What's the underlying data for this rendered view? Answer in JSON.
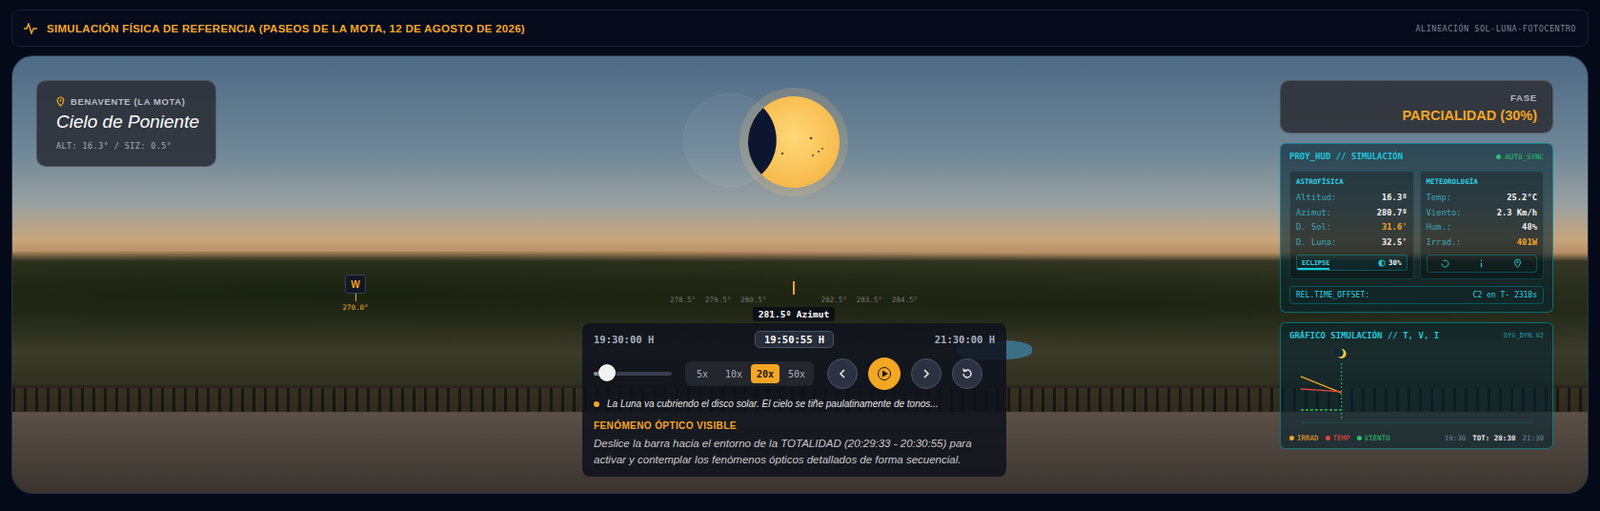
{
  "header": {
    "title": "SIMULACIÓN FÍSICA DE REFERENCIA (PASEOS DE LA MOTA, 12 DE AGOSTO DE 2026)",
    "subtitle": "ALINEACIÓN SOL-LUNA-FOTOCENTRO"
  },
  "location": {
    "place": "BENAVENTE (LA MOTA)",
    "title": "Cielo de Poniente",
    "meta": "ALT: 16.3° / SIZ: 0.5°"
  },
  "sky": {
    "eclipse_coverage": 0.3,
    "compass": {
      "label": "W",
      "degrees": "270.0°"
    },
    "azimuth_ticks": [
      "278.5°",
      "279.5°",
      "280.5°",
      "282.5°",
      "283.5°",
      "284.5°"
    ],
    "azimuth_label": "281.5º Azimut"
  },
  "phase": {
    "label": "FASE",
    "value": "PARCIALIDAD (30%)"
  },
  "timeline": {
    "start": "19:30:00 H",
    "current": "19:50:55 H",
    "end": "21:30:00 H",
    "level": 0.17,
    "speeds": [
      {
        "label": "5x",
        "selected": false
      },
      {
        "label": "10x",
        "selected": false
      },
      {
        "label": "20x",
        "selected": true
      },
      {
        "label": "50x",
        "selected": false
      }
    ],
    "message": "La Luna va cubriendo el disco solar. El cielo se tiñe paulatinamente de tonos...",
    "notice_title": "FENÓMENO ÓPTICO VISIBLE",
    "notice_text": "Deslice la barra hacia el entorno de la TOTALIDAD (20:29:33 - 20:30:55) para activar y contemplar los fenómenos ópticos detallados de forma secuencial."
  },
  "hud": {
    "title": "PROY_HUD // SIMULACIÓN",
    "sync": "AUTO_SYNC",
    "astro": {
      "title": "ASTROFÍSICA",
      "rows": [
        {
          "label": "Altitud:",
          "value": "16.3º",
          "highlight": false
        },
        {
          "label": "Azimut:",
          "value": "280.7º",
          "highlight": false
        },
        {
          "label": "D. Sol:",
          "value": "31.6'",
          "highlight": true
        },
        {
          "label": "D. Luna:",
          "value": "32.5'",
          "highlight": false
        }
      ]
    },
    "eclipse": {
      "label": "ECLIPSE",
      "value": "30%",
      "level": 0.3
    },
    "meteo": {
      "title": "METEOROLOGÍA",
      "rows": [
        {
          "label": "Temp:",
          "value": "25.2°C",
          "highlight": false
        },
        {
          "label": "Viento:",
          "value": "2.3 Km/h",
          "highlight": false
        },
        {
          "label": "Hum.:",
          "value": "48%",
          "highlight": false
        },
        {
          "label": "Irrad.:",
          "value": "401W",
          "highlight": true
        }
      ]
    },
    "offset": {
      "label": "REL.TIME_OFFSET:",
      "value": "C2 en T- 2318s"
    }
  },
  "chart": {
    "title": "GRÁFICO SIMULACIÓN // T, V, I",
    "tag": "SYS_DYN.V2",
    "minutes": [
      0,
      7,
      14,
      21
    ],
    "now_minute": 21,
    "series": [
      {
        "name": "IRRAD",
        "color": "#f5a623",
        "values": [
          640,
          560,
          480,
          401
        ]
      },
      {
        "name": "TEMP",
        "color": "#e8443a",
        "values": [
          27.5,
          26.8,
          26.0,
          25.2
        ]
      },
      {
        "name": "VIENTO",
        "color": "#27c46a",
        "values": [
          2.3,
          2.3,
          2.3,
          2.3
        ]
      }
    ],
    "x_ticks": [
      {
        "label": "19:30",
        "main": false
      },
      {
        "label": "TOT: 20:30",
        "main": true
      },
      {
        "label": "21:30",
        "main": false
      }
    ]
  }
}
